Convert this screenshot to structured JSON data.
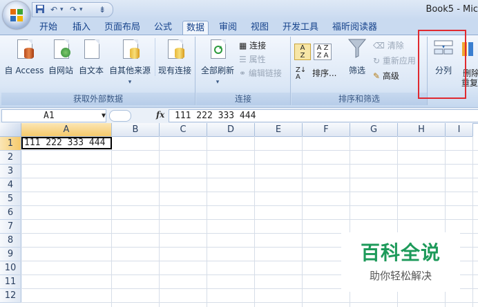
{
  "title": "Book5 - Mic",
  "qat": {
    "undo": "↶",
    "redo": "↷",
    "dropdown": "▾",
    "customize": "⇟"
  },
  "tabs": [
    "开始",
    "插入",
    "页面布局",
    "公式",
    "数据",
    "审阅",
    "视图",
    "开发工具",
    "福昕阅读器"
  ],
  "active_tab": "数据",
  "ribbon": {
    "get_external": {
      "label": "获取外部数据",
      "buttons": [
        "自 Access",
        "自网站",
        "自文本",
        "自其他来源",
        "现有连接"
      ],
      "dropdown": "▾"
    },
    "connections": {
      "label": "连接",
      "refresh_all": "全部刷新",
      "refresh_dropdown": "▾",
      "connections": "连接",
      "properties": "属性",
      "edit_links": "编辑链接"
    },
    "sort_filter": {
      "label": "排序和筛选",
      "sort": "排序...",
      "filter": "筛选",
      "clear": "清除",
      "reapply": "重新应用",
      "advanced": "高级"
    },
    "data_tools": {
      "text_to_columns": "分列",
      "remove_duplicates_1": "删除",
      "remove_duplicates_2": "重复"
    }
  },
  "formula_bar": {
    "name_box": "A1",
    "fx": "fx",
    "value": "111 222 333 444"
  },
  "columns": [
    "A",
    "B",
    "C",
    "D",
    "E",
    "F",
    "G",
    "H",
    "I"
  ],
  "rows": [
    "1",
    "2",
    "3",
    "4",
    "5",
    "6",
    "7",
    "8",
    "9",
    "10",
    "11",
    "12"
  ],
  "cells": {
    "A1": "111 222 333 444"
  },
  "watermark": {
    "line1": "百科全说",
    "line2": "助你轻松解决"
  },
  "colors": {
    "accent": "#15428b",
    "highlight_box": "#e0292f",
    "watermark_green": "#1d9a5a"
  }
}
